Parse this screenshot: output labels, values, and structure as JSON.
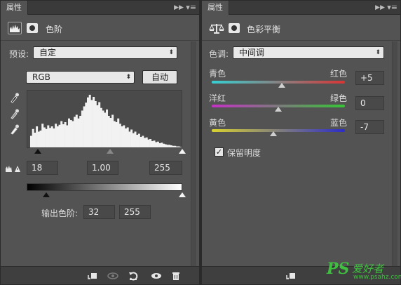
{
  "levels_panel": {
    "tab": "属性",
    "title": "色阶",
    "preset_label": "预设:",
    "preset_value": "自定",
    "channel_value": "RGB",
    "auto_label": "自动",
    "input_black": "18",
    "input_gamma": "1.00",
    "input_white": "255",
    "output_label": "输出色阶:",
    "output_black": "32",
    "output_white": "255",
    "histogram_heights": [
      0.22,
      0.35,
      0.28,
      0.4,
      0.3,
      0.32,
      0.45,
      0.38,
      0.35,
      0.42,
      0.37,
      0.4,
      0.36,
      0.45,
      0.4,
      0.43,
      0.5,
      0.44,
      0.48,
      0.42,
      0.55,
      0.52,
      0.5,
      0.58,
      0.62,
      0.55,
      0.6,
      0.7,
      0.78,
      0.85,
      0.95,
      1.0,
      0.9,
      0.96,
      0.88,
      0.8,
      0.86,
      0.75,
      0.7,
      0.66,
      0.72,
      0.6,
      0.56,
      0.62,
      0.5,
      0.48,
      0.55,
      0.45,
      0.4,
      0.42,
      0.36,
      0.38,
      0.3,
      0.34,
      0.27,
      0.3,
      0.24,
      0.26,
      0.2,
      0.22,
      0.18,
      0.19,
      0.15,
      0.16,
      0.12,
      0.13,
      0.1,
      0.11,
      0.08,
      0.09,
      0.07,
      0.06,
      0.05,
      0.05,
      0.04,
      0.03,
      0.03,
      0.02,
      0.02,
      0.01
    ]
  },
  "color_balance_panel": {
    "tab": "属性",
    "title": "色彩平衡",
    "tone_label": "色调:",
    "tone_value": "中间调",
    "sliders": [
      {
        "left": "青色",
        "right": "红色",
        "value": "+5",
        "num": 5
      },
      {
        "left": "洋红",
        "right": "绿色",
        "value": "0",
        "num": 0
      },
      {
        "left": "黄色",
        "right": "蓝色",
        "value": "-7",
        "num": -7
      }
    ],
    "preserve_label": "保留明度",
    "preserve_checked": true
  },
  "watermark": {
    "logo": "PS",
    "brand": "爱好者",
    "url": "www.psahz.com"
  },
  "colors": {
    "panel": "#535353",
    "tabbar": "#3a3a3a",
    "accent_cyan_red": [
      "#36d0d2",
      "#d83535"
    ],
    "accent_magenta_green": [
      "#c530c5",
      "#34c534"
    ],
    "accent_yellow_blue": [
      "#d8d230",
      "#2c2cc8"
    ]
  }
}
